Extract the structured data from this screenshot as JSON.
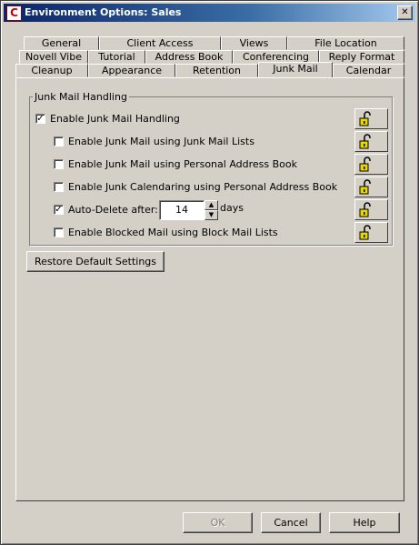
{
  "window": {
    "title": "Environment Options:  Sales",
    "app_icon": "C",
    "close_glyph": "✕"
  },
  "tabs": {
    "row1": [
      "General",
      "Client Access",
      "Views",
      "File Location"
    ],
    "row2": [
      "Novell Vibe",
      "Tutorial",
      "Address Book",
      "Conferencing",
      "Reply Format"
    ],
    "row3": [
      "Cleanup",
      "Appearance",
      "Retention",
      "Junk Mail",
      "Calendar"
    ],
    "active": "Junk Mail"
  },
  "junk_mail": {
    "group_label": "Junk Mail Handling",
    "options": [
      {
        "label": "Enable Junk Mail Handling",
        "checked": true
      },
      {
        "label": "Enable Junk Mail using Junk Mail Lists",
        "checked": false
      },
      {
        "label": "Enable Junk Mail using Personal Address Book",
        "checked": false
      },
      {
        "label": "Enable Junk Calendaring using Personal Address Book",
        "checked": false
      },
      {
        "label": "Auto-Delete after:",
        "checked": true
      },
      {
        "label": "Enable Blocked Mail using Block Mail Lists",
        "checked": false
      }
    ],
    "auto_delete_days": "14",
    "days_label": "days",
    "lock_icon": "unlocked-padlock-icon",
    "restore_label": "Restore Default Settings"
  },
  "footer": {
    "ok_label": "OK",
    "cancel_label": "Cancel",
    "help_label": "Help"
  },
  "colors": {
    "title_start": "#0a246a",
    "title_end": "#a6caf0",
    "face": "#d4d0c8",
    "lock_yellow": "#e8d800"
  }
}
